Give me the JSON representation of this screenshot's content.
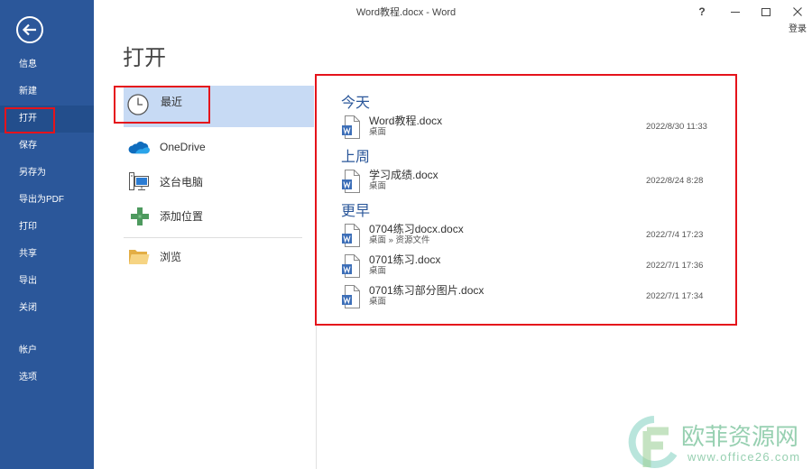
{
  "window": {
    "title": "Word教程.docx - Word",
    "help_glyph": "?",
    "signin_label": "登录",
    "controls": [
      "help-icon",
      "minimize-icon",
      "maximize-icon",
      "close-icon"
    ]
  },
  "sidebar": {
    "back_icon": "back-arrow-icon",
    "items": [
      {
        "label": "信息"
      },
      {
        "label": "新建"
      },
      {
        "label": "打开",
        "selected": true
      },
      {
        "label": "保存"
      },
      {
        "label": "另存为"
      },
      {
        "label": "导出为PDF"
      },
      {
        "label": "打印"
      },
      {
        "label": "共享"
      },
      {
        "label": "导出"
      },
      {
        "label": "关闭"
      }
    ],
    "bottom_items": [
      {
        "label": "帐户"
      },
      {
        "label": "选项"
      }
    ]
  },
  "main": {
    "title": "打开",
    "places": [
      {
        "label": "最近",
        "icon": "clock-icon",
        "selected": true
      },
      {
        "label": "OneDrive",
        "icon": "onedrive-cloud-icon"
      },
      {
        "label": "这台电脑",
        "icon": "computer-icon"
      },
      {
        "label": "添加位置",
        "icon": "add-place-icon"
      },
      {
        "label": "浏览",
        "icon": "folder-icon"
      }
    ]
  },
  "recent": {
    "groups": [
      {
        "heading": "今天",
        "files": [
          {
            "name": "Word教程.docx",
            "location": "桌面",
            "modified": "2022/8/30 11:33",
            "icon": "word-document-icon"
          }
        ]
      },
      {
        "heading": "上周",
        "files": [
          {
            "name": "学习成绩.docx",
            "location": "桌面",
            "modified": "2022/8/24 8:28",
            "icon": "word-document-icon"
          }
        ]
      },
      {
        "heading": "更早",
        "files": [
          {
            "name": "0704练习docx.docx",
            "location": "桌面 » 资源文件",
            "modified": "2022/7/4 17:23",
            "icon": "word-document-icon"
          },
          {
            "name": "0701练习.docx",
            "location": "桌面",
            "modified": "2022/7/1 17:36",
            "icon": "word-document-icon"
          },
          {
            "name": "0701练习部分图片.docx",
            "location": "桌面",
            "modified": "2022/7/1 17:34",
            "icon": "word-document-icon"
          }
        ]
      }
    ]
  },
  "colors": {
    "sidebar_bg": "#2b579a",
    "sidebar_selected_bg": "#234e8c",
    "place_selected_bg": "#c7daf4",
    "group_heading": "#2b579a",
    "annotation_red": "#e5131b",
    "watermark_green": "#86c8a4"
  },
  "watermark": {
    "site_name": "欧菲资源网",
    "url": "www.office26.com"
  }
}
